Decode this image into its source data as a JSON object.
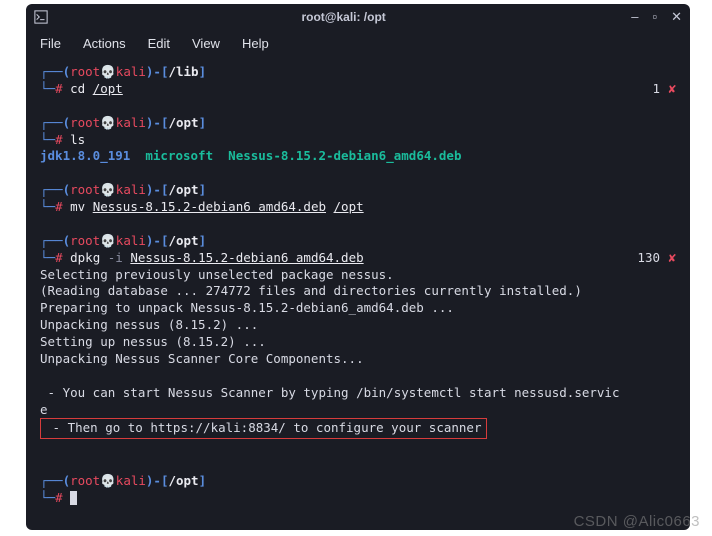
{
  "titlebar": {
    "title": "root@kali: /opt"
  },
  "menu": {
    "file": "File",
    "actions": "Actions",
    "edit": "Edit",
    "view": "View",
    "help": "Help"
  },
  "p1": {
    "user": "root",
    "host": "kali",
    "dir": "/lib",
    "cmd_prefix": "cd ",
    "cmd_arg": "/opt",
    "count": "1",
    "cross": "✘"
  },
  "p2": {
    "user": "root",
    "host": "kali",
    "dir": "/opt",
    "cmd": "ls",
    "out_jdk": "jdk1.8.0_191",
    "out_ms": "microsoft",
    "out_nessus": "Nessus-8.15.2-debian6_amd64.deb"
  },
  "p3": {
    "user": "root",
    "host": "kali",
    "dir": "/opt",
    "cmd_prefix": "mv ",
    "arg1": "Nessus-8.15.2-debian6 amd64.deb",
    "arg2": "/opt"
  },
  "p4": {
    "user": "root",
    "host": "kali",
    "dir": "/opt",
    "cmd_prefix": "dpkg ",
    "flag": "-i ",
    "arg": "Nessus-8.15.2-debian6 amd64.deb",
    "count": "130",
    "cross": "✘",
    "l1": "Selecting previously unselected package nessus.",
    "l2": "(Reading database ... 274772 files and directories currently installed.)",
    "l3": "Preparing to unpack Nessus-8.15.2-debian6_amd64.deb ...",
    "l4": "Unpacking nessus (8.15.2) ...",
    "l5": "Setting up nessus (8.15.2) ...",
    "l6": "Unpacking Nessus Scanner Core Components...",
    "l7a": " - You can start Nessus Scanner by typing /bin/systemctl start nessusd.servic",
    "l7b": "e",
    "l8": " - Then go to https://kali:8834/ to configure your scanner"
  },
  "p5": {
    "user": "root",
    "host": "kali",
    "dir": "/opt"
  },
  "watermark": "CSDN @Alic0663"
}
